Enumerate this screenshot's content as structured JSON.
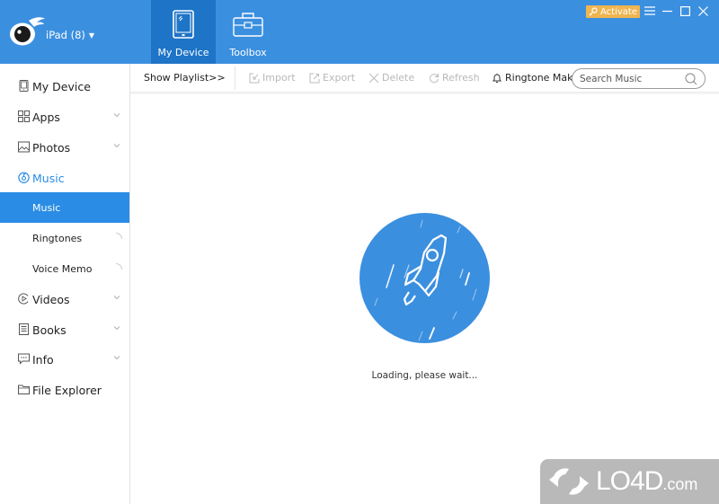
{
  "app": {
    "device_label": "iPad (8)",
    "colors": {
      "accent": "#3b8fdf",
      "accent_dark": "#1e74c6",
      "selected": "#2a8ce5",
      "activate": "#f0b550"
    }
  },
  "header": {
    "tabs": [
      {
        "label": "My Device",
        "icon": "tablet-icon",
        "active": true
      },
      {
        "label": "Toolbox",
        "icon": "toolbox-icon",
        "active": false
      }
    ],
    "activate_label": "Activate",
    "window_controls": [
      "menu-icon",
      "minimize-icon",
      "maximize-icon",
      "close-icon"
    ]
  },
  "sidebar": {
    "items": [
      {
        "label": "My Device",
        "icon": "device-icon",
        "expandable": false
      },
      {
        "label": "Apps",
        "icon": "apps-grid-icon",
        "expandable": true
      },
      {
        "label": "Photos",
        "icon": "photo-icon",
        "expandable": true
      },
      {
        "label": "Music",
        "icon": "music-icon",
        "expandable": false,
        "active": true
      },
      {
        "label": "Music",
        "sub": true,
        "selected": true
      },
      {
        "label": "Ringtones",
        "sub": true,
        "loading": true
      },
      {
        "label": "Voice Memo",
        "sub": true,
        "loading": true
      },
      {
        "label": "Videos",
        "icon": "video-icon",
        "expandable": true
      },
      {
        "label": "Books",
        "icon": "book-icon",
        "expandable": true
      },
      {
        "label": "Info",
        "icon": "chat-icon",
        "expandable": true
      },
      {
        "label": "File Explorer",
        "icon": "folder-icon",
        "expandable": false
      }
    ]
  },
  "toolbar": {
    "show_playlist": "Show Playlist>>",
    "import": "Import",
    "export": "Export",
    "delete": "Delete",
    "refresh": "Refresh",
    "ringtone_maker": "Ringtone Maker",
    "search_placeholder": "Search Music",
    "search_value": ""
  },
  "content": {
    "loading_text": "Loading, please wait..."
  },
  "watermark": {
    "text": "LO4D",
    "suffix": ".com"
  }
}
